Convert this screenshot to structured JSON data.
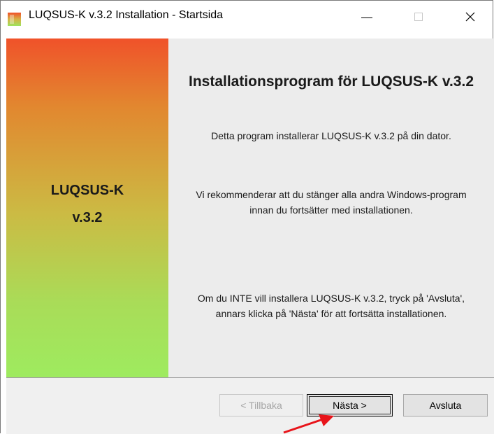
{
  "window": {
    "title": "LUQSUS-K v.3.2 Installation - Startsida",
    "minimize_symbol": "—",
    "maximize_symbol": "",
    "close_symbol": "✕"
  },
  "banner": {
    "name": "LUQSUS-K",
    "version": "v.3.2"
  },
  "content": {
    "heading": "Installationsprogram för LUQSUS-K v.3.2",
    "paragraph1": "Detta program installerar LUQSUS-K v.3.2 på din dator.",
    "paragraph2": "Vi rekommenderar att du stänger alla andra Windows-program innan du fortsätter med installationen.",
    "paragraph3": "Om du INTE vill installera LUQSUS-K v.3.2, tryck på 'Avsluta', annars klicka på 'Nästa' för att fortsätta installationen."
  },
  "buttons": {
    "back": "< Tillbaka",
    "next": "Nästa >",
    "cancel": "Avsluta"
  },
  "colors": {
    "banner_top": "#f0522a",
    "banner_bottom": "#9eeb5f",
    "annotation_arrow": "#e8141a"
  }
}
